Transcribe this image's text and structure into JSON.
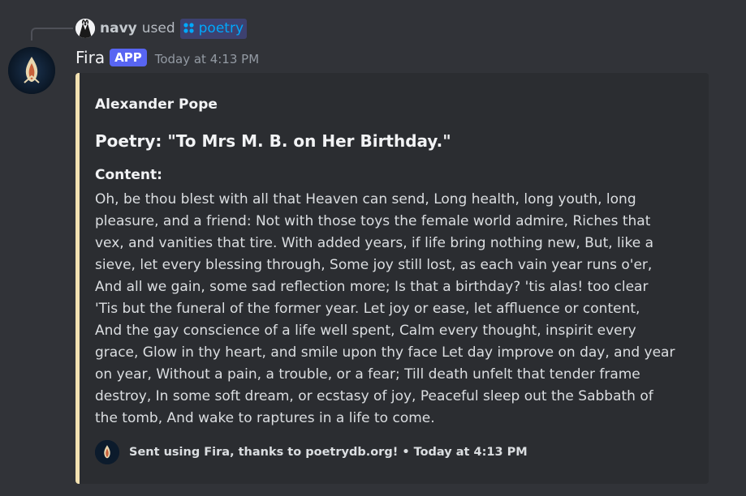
{
  "interaction": {
    "user": "navy",
    "verb": "used",
    "command": "poetry"
  },
  "message": {
    "author": "Fira",
    "badge": "APP",
    "timestamp": "Today at 4:13 PM"
  },
  "embed": {
    "accent_color": "#f3e2b2",
    "author": "Alexander Pope",
    "title": "Poetry: \"To Mrs M. B. on Her Birthday.\"",
    "field_name": "Content:",
    "lines": [
      "Oh, be thou blest with all that Heaven can send, Long health, long youth, long",
      "pleasure, and a friend: Not with those toys the female world admire, Riches that",
      "vex, and vanities that tire. With added years, if life bring nothing new, But, like a",
      "sieve, let every blessing through, Some joy still lost, as each vain year runs o'er,",
      "And all we gain, some sad reflection more; Is that a birthday? 'tis alas! too clear",
      "'Tis but the funeral of the former year. Let joy or ease, let affluence or content,",
      "And the gay conscience of a life well spent, Calm every thought, inspirit every",
      "grace, Glow in thy heart, and smile upon thy face Let day improve on day, and year",
      "on year, Without a pain, a trouble, or a fear; Till death unfelt that tender frame",
      "destroy, In some soft dream, or ecstasy of joy, Peaceful sleep out the Sabbath of",
      "the tomb, And wake to raptures in a life to come."
    ],
    "footer_text": "Sent using Fira, thanks to poetrydb.org!",
    "footer_separator": "•",
    "footer_timestamp": "Today at 4:13 PM"
  },
  "icons": {
    "interaction_avatar": "tuxedo-avatar-icon",
    "command": "app-command-icon",
    "bot_avatar": "flame-logo-icon"
  }
}
